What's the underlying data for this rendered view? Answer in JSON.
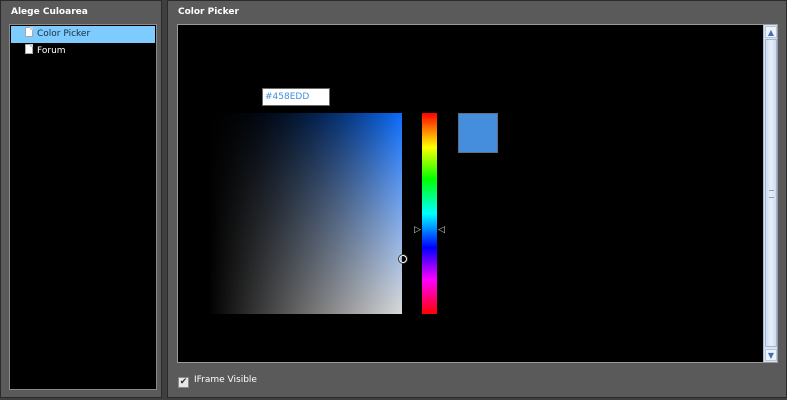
{
  "left_panel": {
    "title": "Alege Culoarea",
    "tree": [
      {
        "label": "Color Picker",
        "icon": "document-icon",
        "selected": true
      },
      {
        "label": "Forum",
        "icon": "document-icon",
        "selected": false
      }
    ]
  },
  "right_panel": {
    "title": "Color Picker",
    "picker": {
      "hex_value": "#458EDD",
      "selected_color": "#458edd",
      "hue_marker_left": "▷",
      "hue_marker_right": "◁"
    },
    "scrollbar": {
      "up_arrow": "▲",
      "down_arrow": "▼"
    },
    "iframe_visible": {
      "label": "IFrame Visible",
      "checked": true,
      "check_glyph": "✔"
    }
  },
  "colors": {
    "selection": "#7ecbff",
    "panel": "#5a5a5a",
    "canvas": "#000000"
  }
}
